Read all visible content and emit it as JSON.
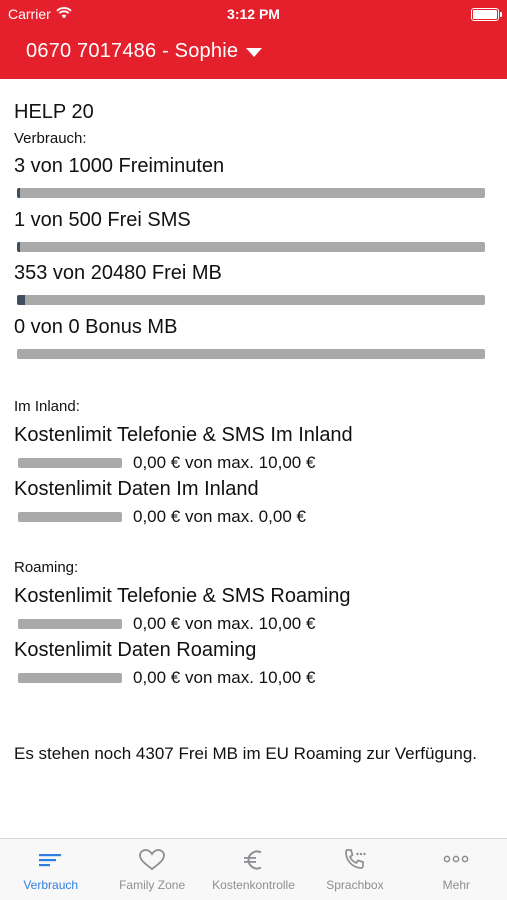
{
  "status_bar": {
    "carrier": "Carrier",
    "time": "3:12 PM"
  },
  "nav": {
    "title": "0670 7017486 - Sophie"
  },
  "plan": {
    "name": "HELP 20",
    "usage_label": "Verbrauch:"
  },
  "usage": [
    {
      "label": "3 von 1000 Freiminuten",
      "fraction": 0.003
    },
    {
      "label": "1 von 500 Frei SMS",
      "fraction": 0.002
    },
    {
      "label": "353 von 20480 Frei MB",
      "fraction": 0.017
    },
    {
      "label": "0 von 0 Bonus MB",
      "fraction": 0
    }
  ],
  "inland": {
    "heading": "Im Inland:",
    "limits": [
      {
        "label": "Kostenlimit Telefonie & SMS Im Inland",
        "value": "0,00 € von max. 10,00 €"
      },
      {
        "label": "Kostenlimit Daten Im Inland",
        "value": "0,00 € von max. 0,00 €"
      }
    ]
  },
  "roaming": {
    "heading": "Roaming:",
    "limits": [
      {
        "label": "Kostenlimit Telefonie & SMS Roaming",
        "value": "0,00 € von max. 10,00 €"
      },
      {
        "label": "Kostenlimit Daten Roaming",
        "value": "0,00 € von max. 10,00 €"
      }
    ]
  },
  "note": "Es stehen noch 4307 Frei MB im EU Roaming zur Verfügung.",
  "tabs": [
    {
      "label": "Verbrauch",
      "icon": "usage-lines-icon",
      "active": true
    },
    {
      "label": "Family Zone",
      "icon": "heart-icon",
      "active": false
    },
    {
      "label": "Kostenkontrolle",
      "icon": "euro-icon",
      "active": false
    },
    {
      "label": "Sprachbox",
      "icon": "voicemail-phone-icon",
      "active": false
    },
    {
      "label": "Mehr",
      "icon": "more-dots-icon",
      "active": false
    }
  ],
  "colors": {
    "brand_red": "#e3202c",
    "active_tab": "#2f7fe0",
    "bar_track": "#a9a9a9",
    "bar_fill": "#3d4f5e"
  }
}
